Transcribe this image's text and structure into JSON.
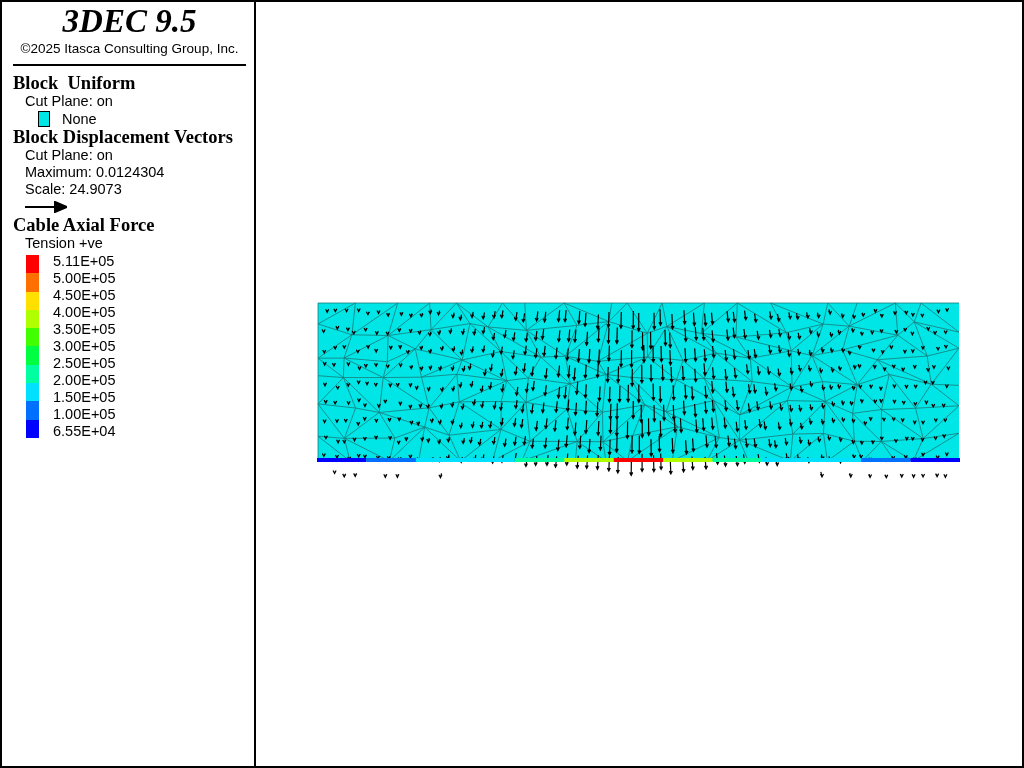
{
  "header": {
    "title": "3DEC 9.5",
    "copyright": "©2025 Itasca Consulting Group, Inc."
  },
  "legend": [
    {
      "kind": "uniform",
      "heading": "Block  Uniform",
      "lines": [
        "Cut Plane: on"
      ],
      "swatch": {
        "color": "#00e6e6",
        "label": "None"
      }
    },
    {
      "kind": "vectors",
      "heading": "Block Displacement Vectors",
      "lines": [
        "Cut Plane: on",
        "Maximum: 0.0124304",
        "Scale: 24.9073"
      ]
    },
    {
      "kind": "contour",
      "heading": "Cable Axial Force",
      "lines": [
        "Tension +ve"
      ],
      "colors": [
        {
          "color": "#ff0000"
        },
        {
          "color": "#ff7000"
        },
        {
          "color": "#ffe000"
        },
        {
          "color": "#b0ff00"
        },
        {
          "color": "#40ff00"
        },
        {
          "color": "#00ff40"
        },
        {
          "color": "#00ffa0"
        },
        {
          "color": "#00e0ff"
        },
        {
          "color": "#0070ff"
        },
        {
          "color": "#0000ff"
        }
      ],
      "labels": [
        "5.11E+05",
        "5.00E+05",
        "4.50E+05",
        "4.00E+05",
        "3.50E+05",
        "3.00E+05",
        "2.50E+05",
        "2.00E+05",
        "1.50E+05",
        "1.00E+05",
        "6.55E+04"
      ]
    }
  ]
}
